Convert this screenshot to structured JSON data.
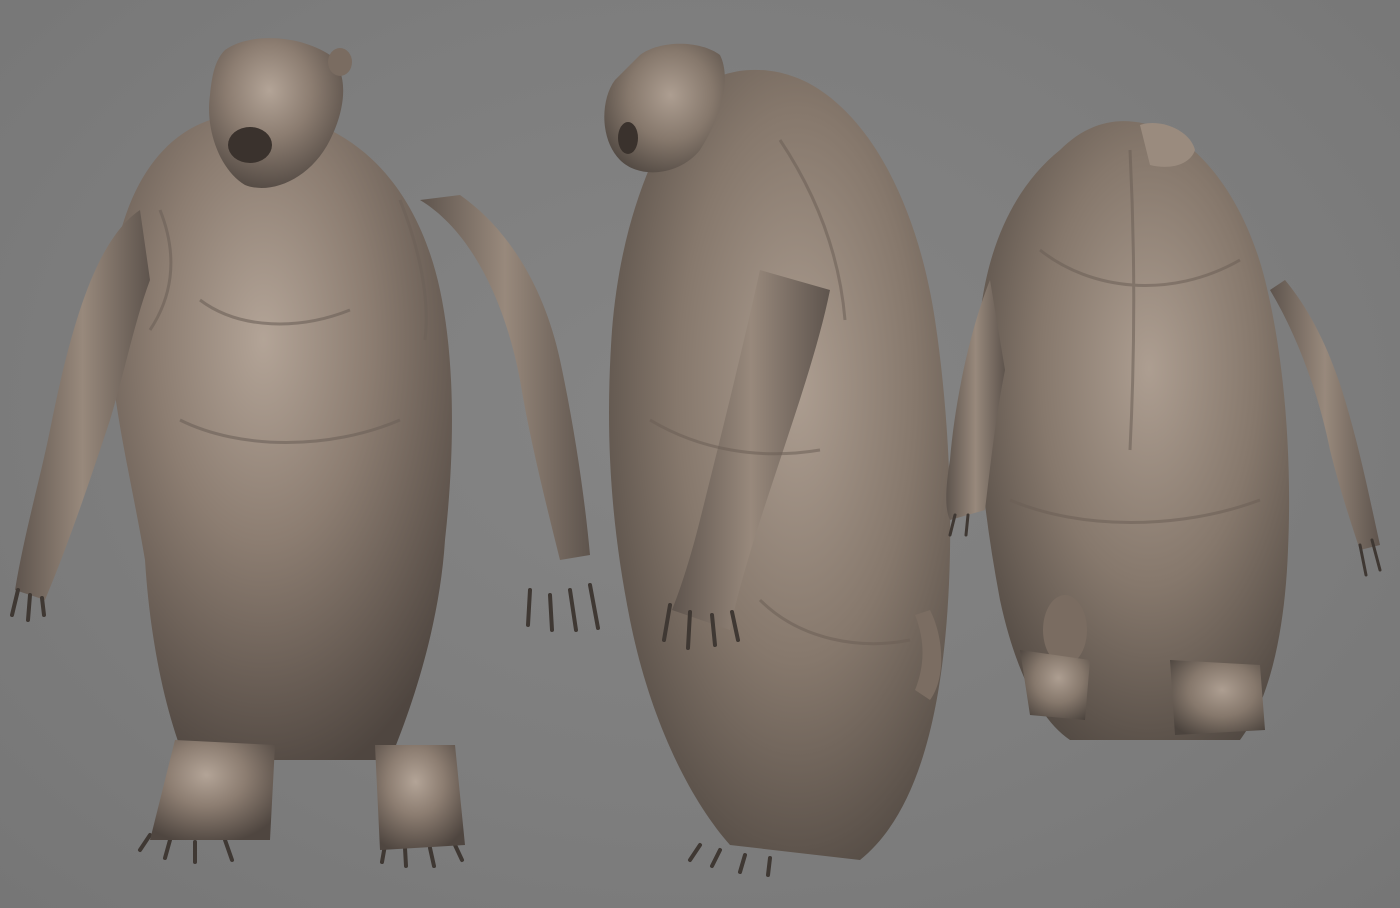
{
  "scene": {
    "background_color": "#7f7f7f",
    "clay_color": "#8c7d71",
    "clay_highlight": "#b3a497",
    "clay_shadow": "#4f4640",
    "models": [
      {
        "view": "front-three-quarter",
        "icon": "creature-front-view"
      },
      {
        "view": "side",
        "icon": "creature-side-view"
      },
      {
        "view": "back",
        "icon": "creature-back-view"
      }
    ]
  }
}
